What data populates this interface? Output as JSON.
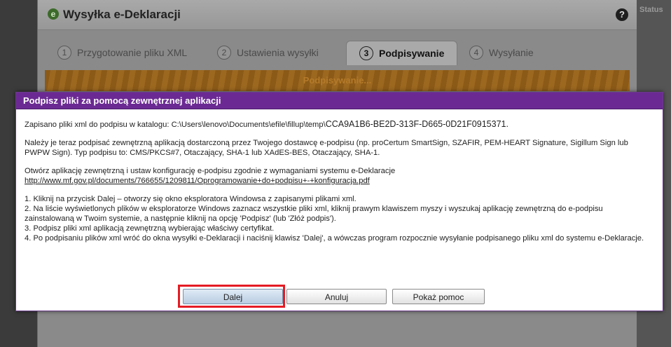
{
  "background_window": {
    "title": "Wysyłka e-Deklaracji",
    "logo_glyph": "e",
    "help_glyph": "?",
    "tabs": [
      {
        "num": "1",
        "label": "Przygotowanie pliku XML"
      },
      {
        "num": "2",
        "label": "Ustawienia wysyłki"
      },
      {
        "num": "3",
        "label": "Podpisywanie"
      },
      {
        "num": "4",
        "label": "Wysyłanie"
      }
    ],
    "progress_label": "Podpisywanie...",
    "right_panel_label": "Status"
  },
  "dialog": {
    "title": "Podpisz pliki za pomocą zewnętrznej aplikacji",
    "saved_prefix": "Zapisano pliki xml do podpisu w katalogu: C:\\Users\\lenovo\\Documents\\efile\\fillup\\temp\\",
    "saved_id": "CCA9A1B6-BE2D-313F-D665-0D21F0915371.",
    "instructions": "Należy je teraz podpisać zewnętrzną aplikacją dostarczoną przez Twojego dostawcę e-podpisu (np. proCertum SmartSign, SZAFIR, PEM-HEART Signature, Sigillum Sign lub PWPW Sign). Typ podpisu to: CMS/PKCS#7, Otaczający, SHA-1 lub XAdES-BES, Otaczający, SHA-1.",
    "config_text": "Otwórz aplikację zewnętrzną i ustaw konfigurację e-podpisu zgodnie z wymaganiami systemu e-Deklaracje",
    "config_link": "http://www.mf.gov.pl/documents/766655/1209811/Oprogramowanie+do+podpisu+-+konfiguracja.pdf",
    "steps": [
      "1. Kliknij na przycisk Dalej – otworzy się okno eksploratora Windowsa z zapisanymi plikami xml.",
      "2. Na liście wyświetlonych plików w eksploratorze Windows zaznacz wszystkie pliki xml, kliknij prawym klawiszem myszy i wyszukaj aplikację zewnętrzną do e-podpisu zainstalowaną w Twoim systemie, a następnie kliknij na opcję 'Podpisz' (lub 'Złóż podpis').",
      "3. Podpisz pliki xml aplikacją zewnętrzną wybierając właściwy certyfikat.",
      "4. Po podpisaniu plików xml wróć do okna wysyłki e-Deklaracji i naciśnij klawisz 'Dalej', a wówczas program rozpocznie wysyłanie podpisanego pliku xml do systemu e-Deklaracje."
    ],
    "buttons": {
      "next": "Dalej",
      "cancel": "Anuluj",
      "help": "Pokaż pomoc"
    }
  },
  "colors": {
    "dialog_header": "#6b2a93",
    "highlight": "#e41c24"
  }
}
